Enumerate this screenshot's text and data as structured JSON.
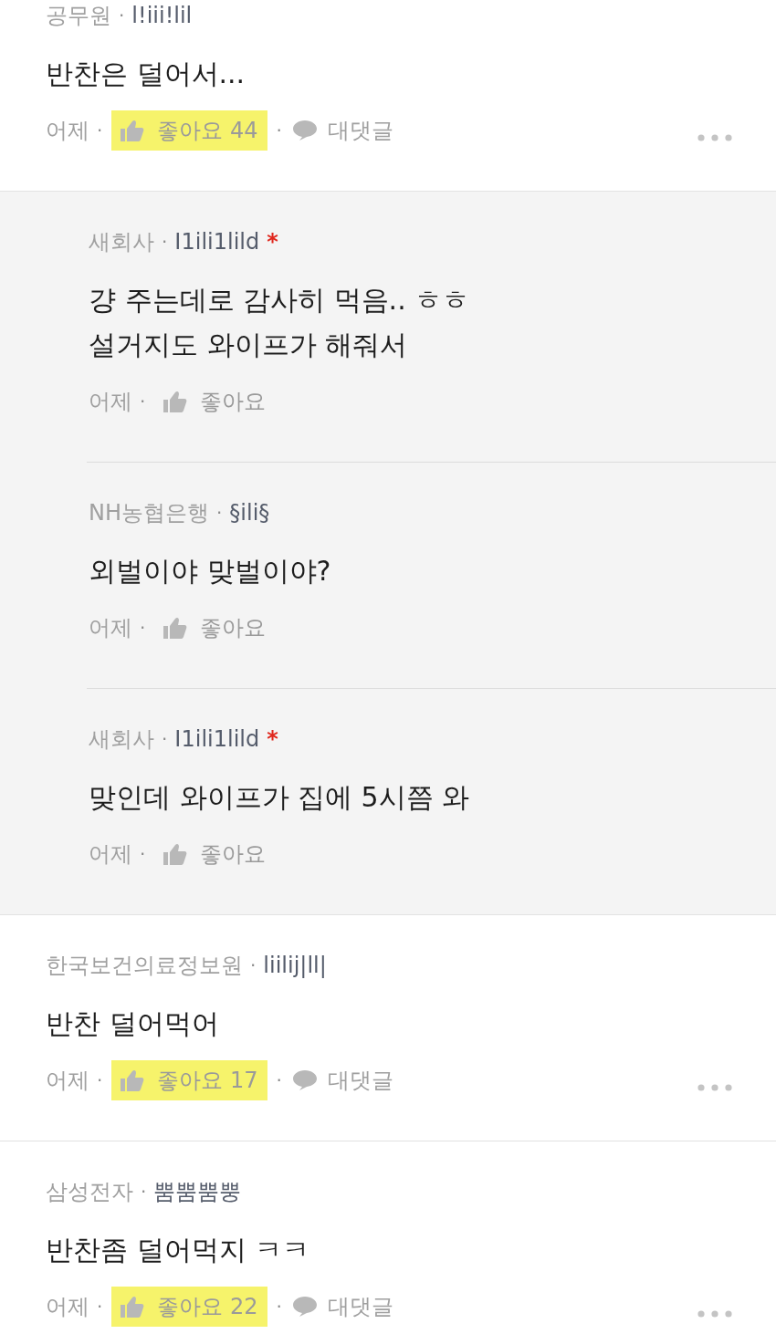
{
  "comments": [
    {
      "company": "공무원",
      "nickname": "l!iii!lil",
      "op": false,
      "body": [
        "반찬은 덜어서..."
      ],
      "time": "어제",
      "like": {
        "label": "좋아요 44",
        "highlighted": true
      },
      "reply_label": "대댓글",
      "replies": [
        {
          "company": "새회사",
          "nickname": "I1ili1lild",
          "op": true,
          "body": [
            "걍 주는데로 감사히 먹음.. ㅎㅎ",
            "설거지도 와이프가 해줘서"
          ],
          "time": "어제",
          "like": {
            "label": "좋아요",
            "highlighted": false
          }
        },
        {
          "company": "NH농협은행",
          "nickname": "§ili§",
          "op": false,
          "body": [
            "외벌이야 맞벌이야?"
          ],
          "time": "어제",
          "like": {
            "label": "좋아요",
            "highlighted": false
          }
        },
        {
          "company": "새회사",
          "nickname": "I1ili1lild",
          "op": true,
          "body": [
            "맞인데 와이프가 집에 5시쯤 와"
          ],
          "time": "어제",
          "like": {
            "label": "좋아요",
            "highlighted": false
          }
        }
      ]
    },
    {
      "company": "한국보건의료정보원",
      "nickname": "liilij|ll|",
      "op": false,
      "body": [
        "반찬 덜어먹어"
      ],
      "time": "어제",
      "like": {
        "label": "좋아요 17",
        "highlighted": true
      },
      "reply_label": "대댓글"
    },
    {
      "company": "삼성전자",
      "nickname": "뿜뿜뿜뿡",
      "op": false,
      "body": [
        "반찬좀 덜어먹지 ㅋㅋ"
      ],
      "time": "어제",
      "like": {
        "label": "좋아요 22",
        "highlighted": true
      },
      "reply_label": "대댓글"
    }
  ],
  "op_mark": "*",
  "separator": "·"
}
